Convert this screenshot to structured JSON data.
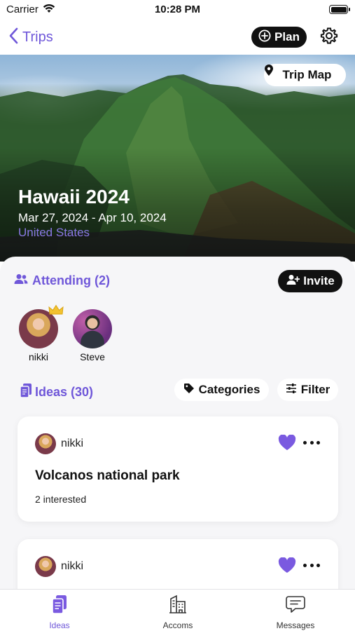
{
  "status_bar": {
    "carrier": "Carrier",
    "time": "10:28 PM"
  },
  "nav": {
    "back_label": "Trips",
    "plan_label": "Plan"
  },
  "hero": {
    "trip_map_label": "Trip Map",
    "title": "Hawaii 2024",
    "dates": "Mar 27, 2024 - Apr 10, 2024",
    "country": "United States"
  },
  "attending": {
    "label": "Attending (2)",
    "invite_label": "Invite",
    "people": [
      {
        "name": "nikki",
        "is_owner": true
      },
      {
        "name": "Steve",
        "is_owner": false
      }
    ]
  },
  "ideas": {
    "label": "Ideas (30)",
    "categories_label": "Categories",
    "filter_label": "Filter",
    "cards": [
      {
        "author": "nikki",
        "title": "Volcanos national park",
        "interested": "2 interested",
        "liked": true
      },
      {
        "author": "nikki",
        "liked": true
      }
    ]
  },
  "tabbar": {
    "items": [
      {
        "label": "Ideas",
        "icon": "ideas-icon",
        "active": true
      },
      {
        "label": "Accoms",
        "icon": "building-icon",
        "active": false
      },
      {
        "label": "Messages",
        "icon": "chat-icon",
        "active": false
      }
    ]
  },
  "colors": {
    "accent": "#6f57d9",
    "dark": "#111111",
    "sheet": "#f6f6f8"
  }
}
